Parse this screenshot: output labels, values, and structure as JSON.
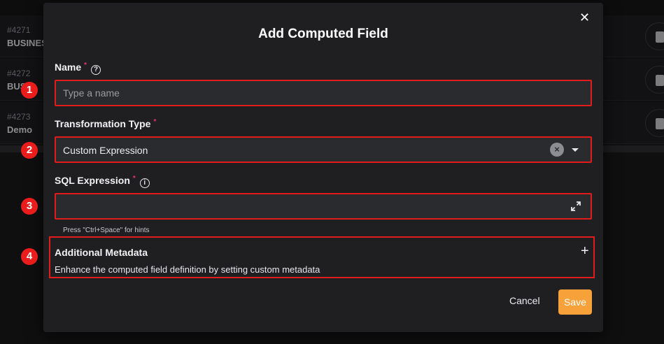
{
  "background": {
    "rows": [
      {
        "id": "#4271",
        "name": "BUSINES"
      },
      {
        "id": "#4272",
        "name": "BUS"
      },
      {
        "id": "#4273",
        "name": "Demo"
      }
    ]
  },
  "modal": {
    "title": "Add Computed Field",
    "close_icon": "close-icon",
    "name": {
      "label": "Name",
      "required": "*",
      "placeholder": "Type a name",
      "value": ""
    },
    "transformation": {
      "label": "Transformation Type",
      "required": "*",
      "value": "Custom Expression"
    },
    "sql": {
      "label": "SQL Expression",
      "required": "*",
      "value": "",
      "hint": "Press \"Ctrl+Space\" for hints"
    },
    "metadata": {
      "title": "Additional Metadata",
      "description": "Enhance the computed field definition by setting custom metadata",
      "expand_symbol": "+"
    },
    "actions": {
      "cancel_label": "Cancel",
      "save_label": "Save"
    }
  },
  "markers": [
    "1",
    "2",
    "3",
    "4"
  ],
  "colors": {
    "accent": "#f7a13a",
    "highlight": "#e21b1b",
    "required": "#e8336e",
    "marker": "#ea1c1c"
  }
}
